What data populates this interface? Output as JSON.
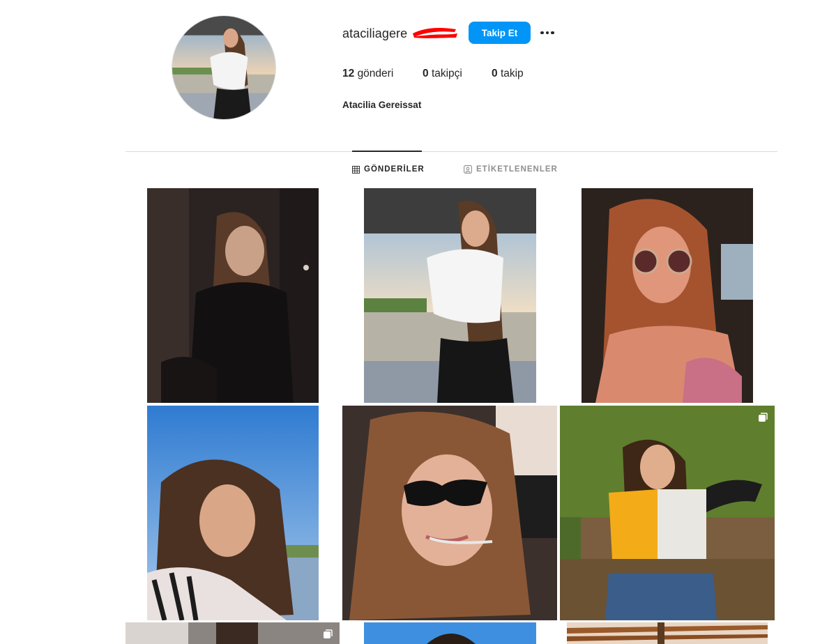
{
  "profile": {
    "username": "ataciliagere",
    "follow_label": "Takip Et",
    "more_icon": "ellipsis-icon",
    "full_name": "Atacilia Gereissat",
    "stats": {
      "posts_count": "12",
      "posts_label": "gönderi",
      "followers_count": "0",
      "followers_label": "takipçi",
      "following_count": "0",
      "following_label": "takip"
    }
  },
  "tabs": [
    {
      "label": "GÖNDERİLER",
      "icon": "grid-icon",
      "active": true
    },
    {
      "label": "ETİKETLENENLER",
      "icon": "tagged-user-icon",
      "active": false
    }
  ],
  "colors": {
    "follow_button": "#0095f6",
    "text": "#262626",
    "muted": "#8e8e8e",
    "divider": "#dbdbdb",
    "redaction": "#ff0000"
  },
  "posts": [
    {
      "description": "girl black mesh top dark room",
      "multi": false
    },
    {
      "description": "girl white crop top outdoors sky",
      "multi": false
    },
    {
      "description": "girl round sunglasses in car",
      "multi": false
    },
    {
      "description": "girl selfie blue sky lake",
      "multi": false
    },
    {
      "description": "girl cat-eye sunglasses in car",
      "multi": false
    },
    {
      "description": "girl yellow white crop top trees",
      "multi": true
    },
    {
      "description": "partial post",
      "multi": true
    },
    {
      "description": "partial post",
      "multi": false
    },
    {
      "description": "partial post",
      "multi": false
    }
  ]
}
